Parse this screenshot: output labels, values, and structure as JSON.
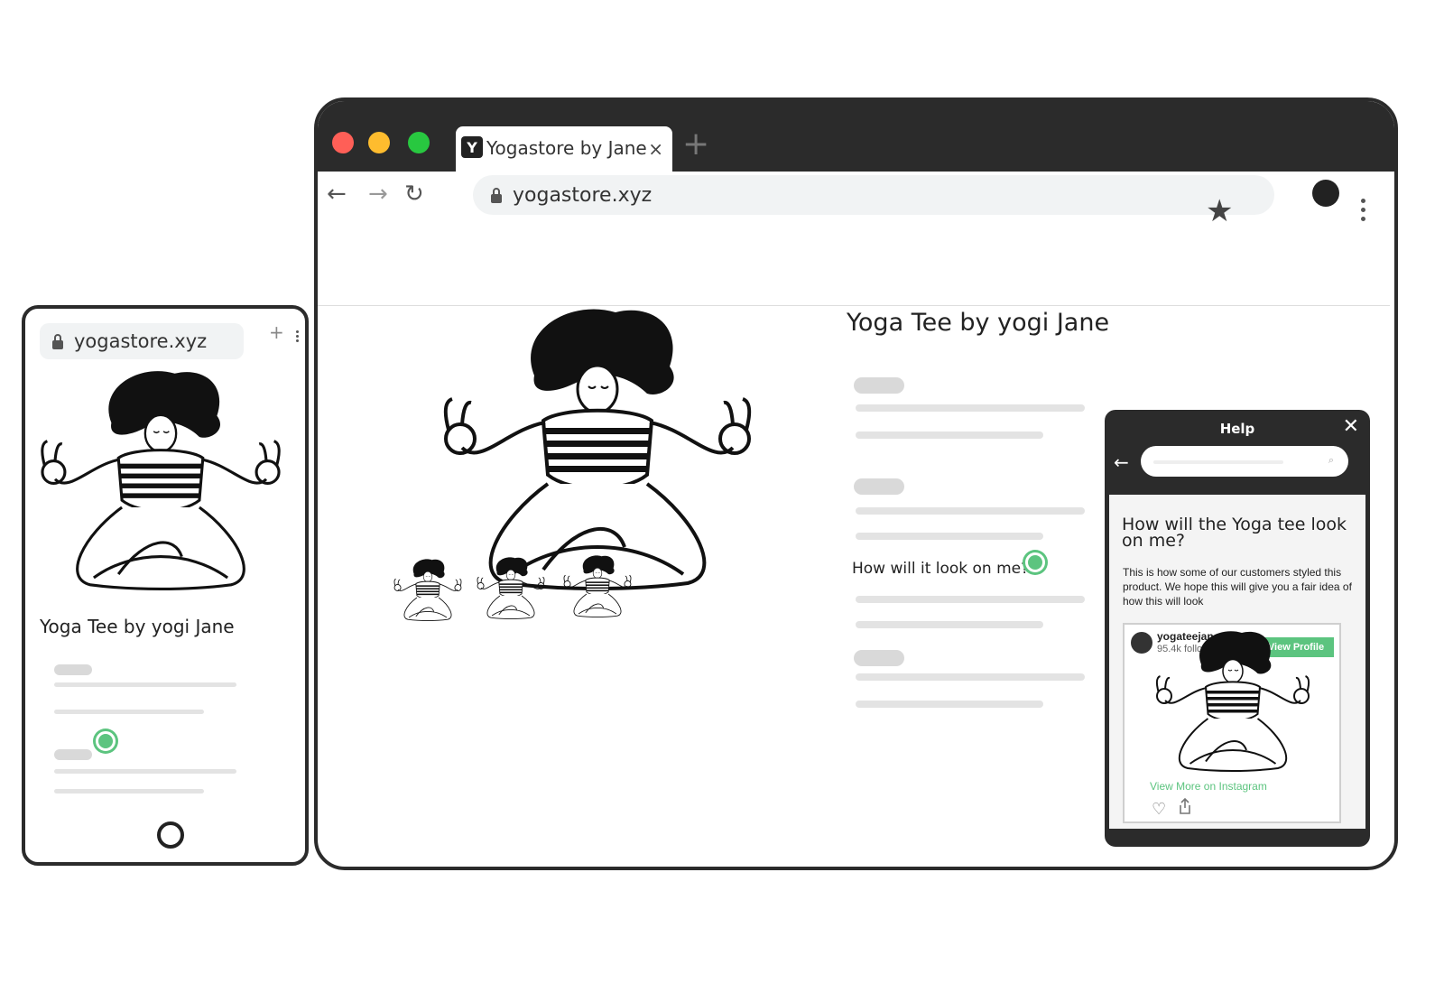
{
  "browser": {
    "tab_title": "Yogastore by Jane",
    "tab_favicon": "Y",
    "tab_close": "×",
    "new_tab": "+",
    "url": "yogastore.xyz",
    "icons": [
      "back-arrow-icon",
      "forward-arrow-icon",
      "reload-icon",
      "lock-icon",
      "star-icon",
      "profile-icon",
      "kebab-menu-icon"
    ],
    "window_controls": {
      "close": "#ff5f57",
      "minimize": "#febc2e",
      "maximize": "#28c840"
    }
  },
  "product": {
    "title": "Yoga Tee by yogi Jane",
    "ask_link": "How will it look on me?"
  },
  "help": {
    "title": "Help",
    "close": "✕",
    "back": "←",
    "search_icon": "⌕",
    "heading": "How will the Yoga tee look on me?",
    "body": "This is how some of our customers styled this product. We hope this will give you a fair idea of how this will look",
    "instagram": {
      "username": "yogateejane",
      "followers": "95.4k followers",
      "view_profile": "View Profile",
      "view_more": "View More on Instagram",
      "heart": "♡"
    }
  },
  "mobile": {
    "url": "yogastore.xyz",
    "new_tab": "+",
    "title": "Yoga Tee by yogi Jane"
  },
  "colors": {
    "frame": "#2b2b2b",
    "accent_green": "#5cc47f",
    "skeleton": "#d9d9d9"
  }
}
